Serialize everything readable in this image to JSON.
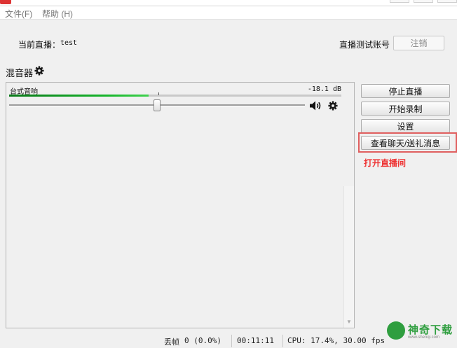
{
  "window": {
    "title": ""
  },
  "menu": {
    "items": [
      "文件(F)",
      "帮助 (H)"
    ]
  },
  "header": {
    "current_label": "当前直播：",
    "current_value": "test",
    "account_label": "直播测试账号",
    "logout_label": "注销"
  },
  "mixer": {
    "title": "混音器",
    "source": {
      "name": "台式音响",
      "level_db": "-18.1 dB",
      "meter_fraction": 0.42,
      "volume_fraction": 0.5
    }
  },
  "actions": {
    "stop_stream": "停止直播",
    "start_record": "开始录制",
    "settings": "设置",
    "chat_gifts": "查看聊天/送礼消息"
  },
  "annotation": {
    "text": "打开直播间",
    "color": "#ee3333"
  },
  "status": {
    "dropped_label": "丢帧",
    "dropped_value": "0 (0.0%)",
    "time": "00:11:11",
    "cpu": "CPU: 17.4%, 30.00 fps"
  },
  "watermark": {
    "brand": "神奇下载",
    "url": "www.shenqi.com",
    "color": "#2f9e3f"
  }
}
